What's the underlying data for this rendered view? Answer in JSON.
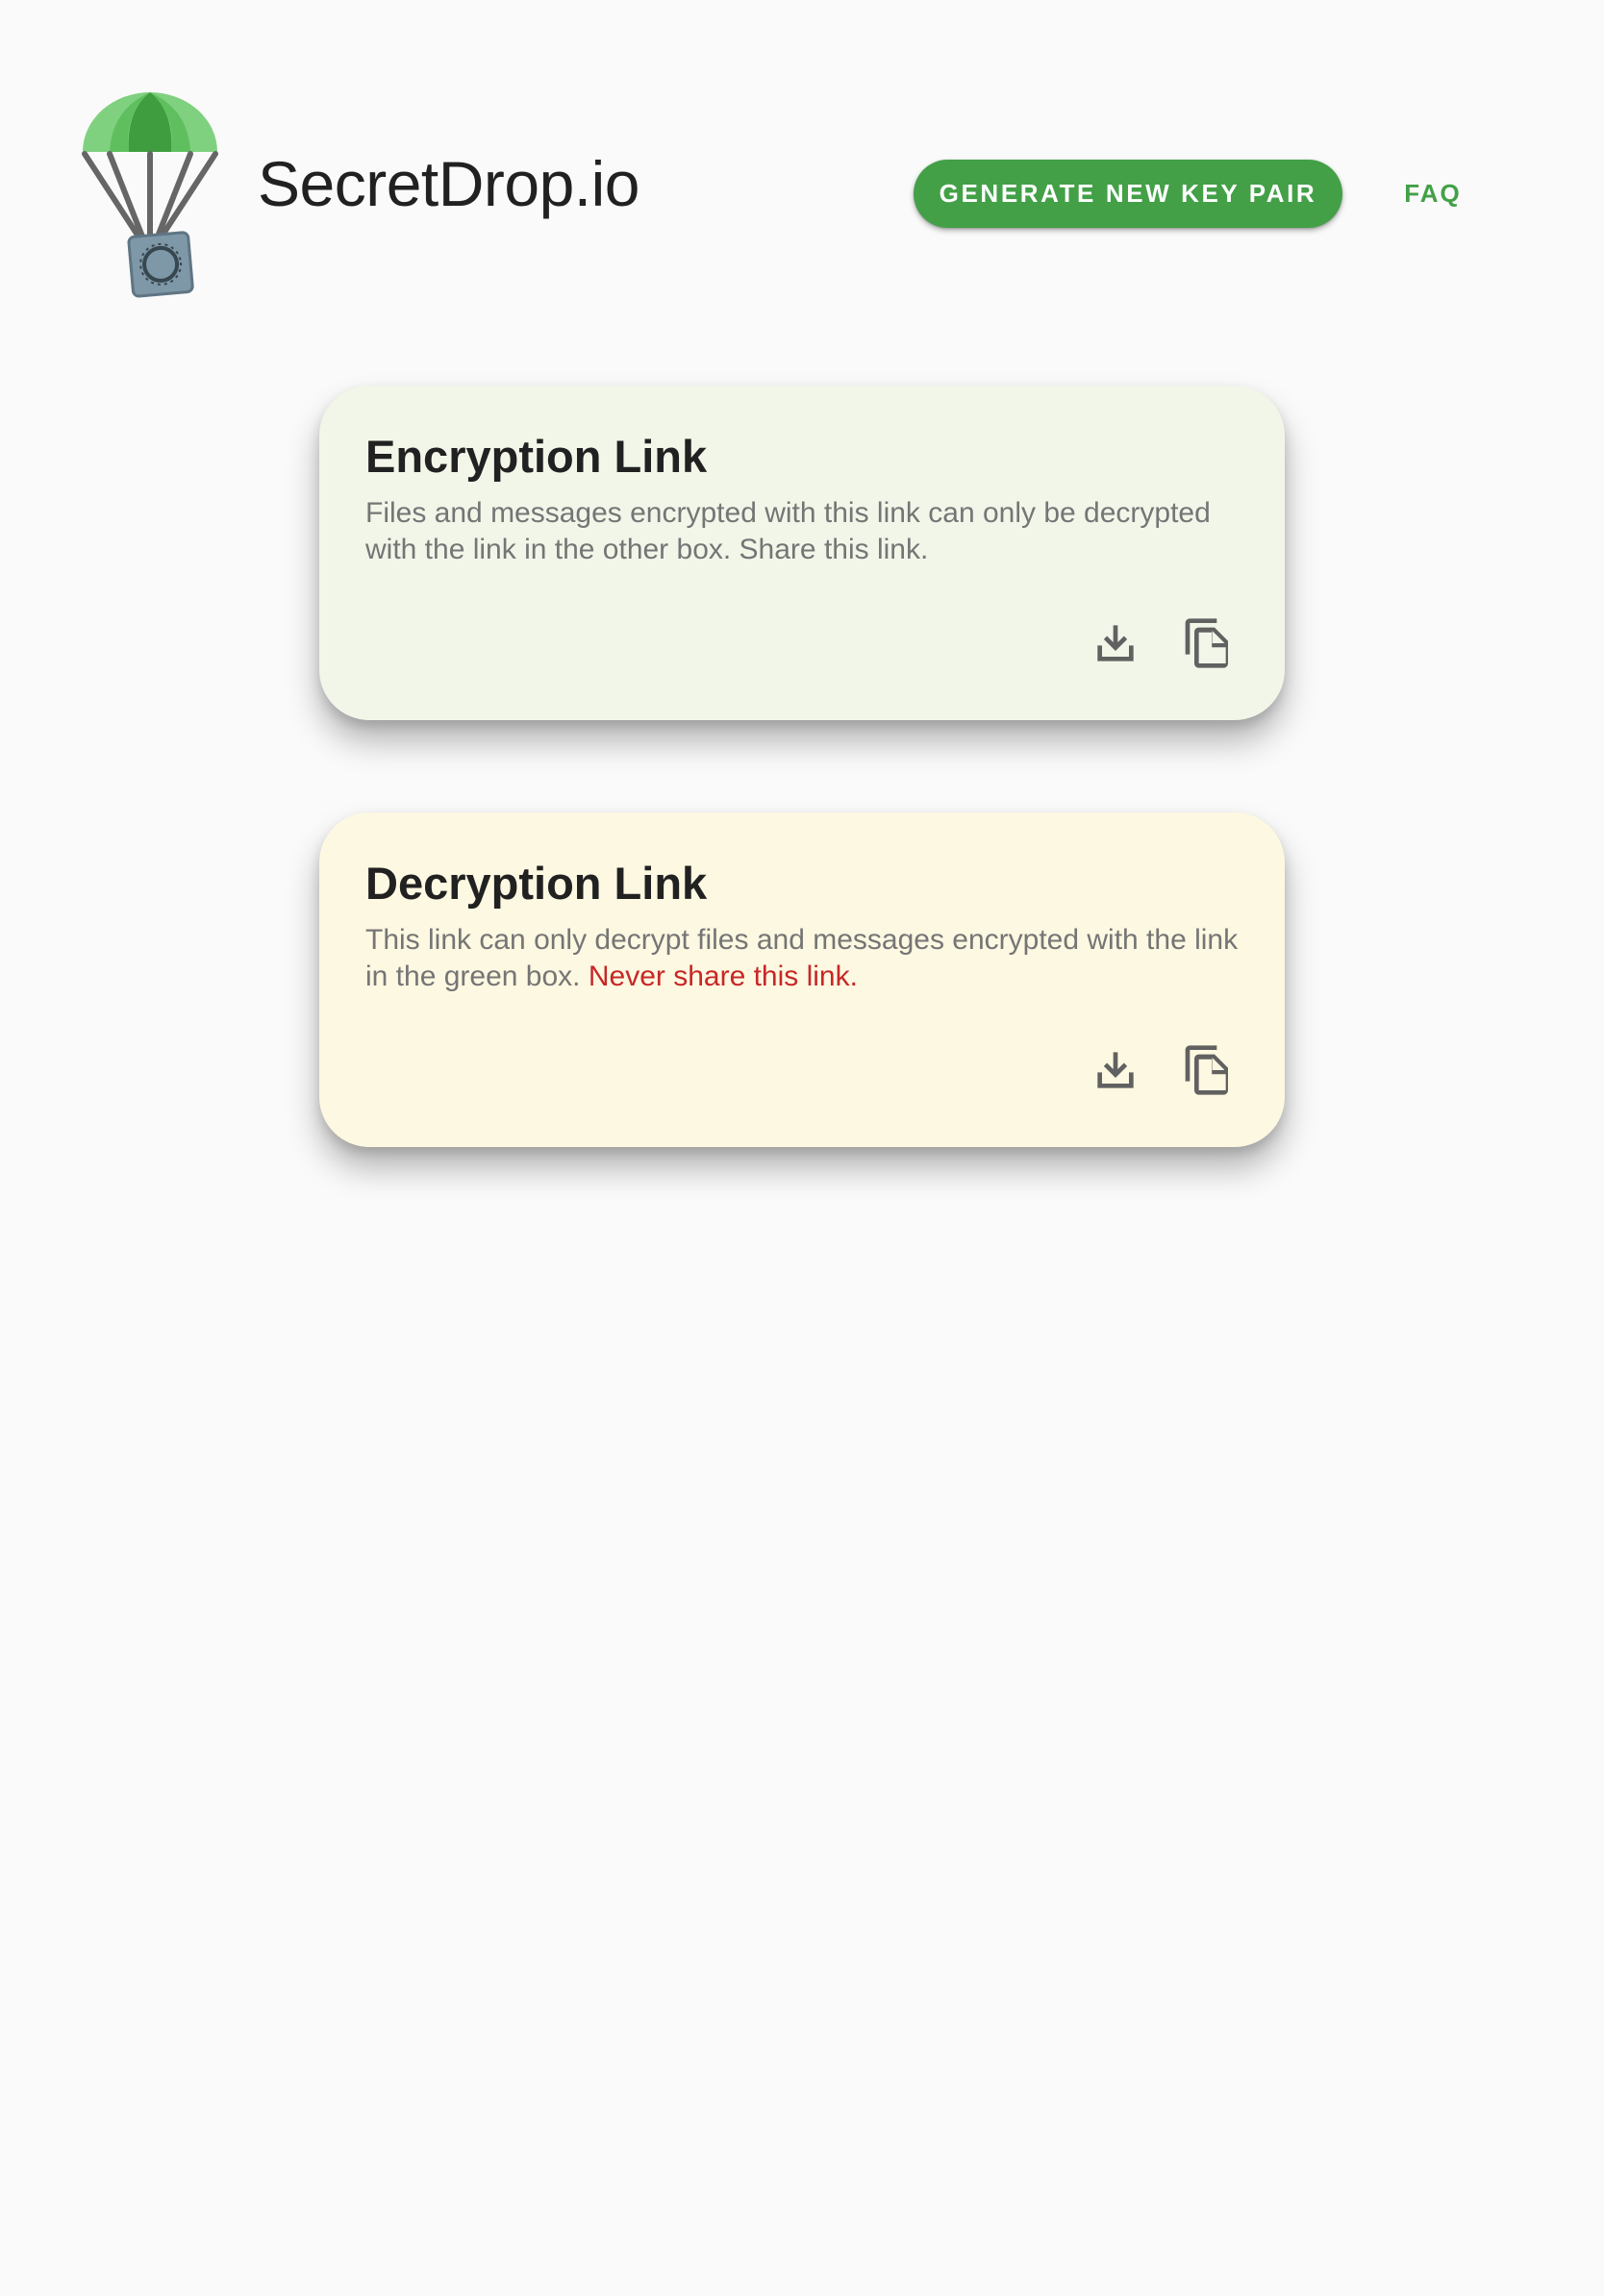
{
  "header": {
    "app_title": "SecretDrop.io",
    "generate_button_label": "GENERATE NEW KEY PAIR",
    "faq_label": "FAQ",
    "logo_icon": "parachute-safe-logo"
  },
  "encryption_card": {
    "title": "Encryption Link",
    "description": "Files and messages encrypted with this link can only be decrypted with the link in the other box. Share this link.",
    "icons": [
      "download-icon",
      "copy-icon"
    ],
    "background": "#f1f6e9"
  },
  "decryption_card": {
    "title": "Decryption Link",
    "description": "This link can only decrypt files and messages encrypted with the link in the green box.",
    "warning": "Never share this link.",
    "icons": [
      "download-icon",
      "copy-icon"
    ],
    "background": "#fdf8e1"
  },
  "colors": {
    "accent": "#43a047",
    "warning": "#c62828",
    "page_background": "#fafafa"
  }
}
